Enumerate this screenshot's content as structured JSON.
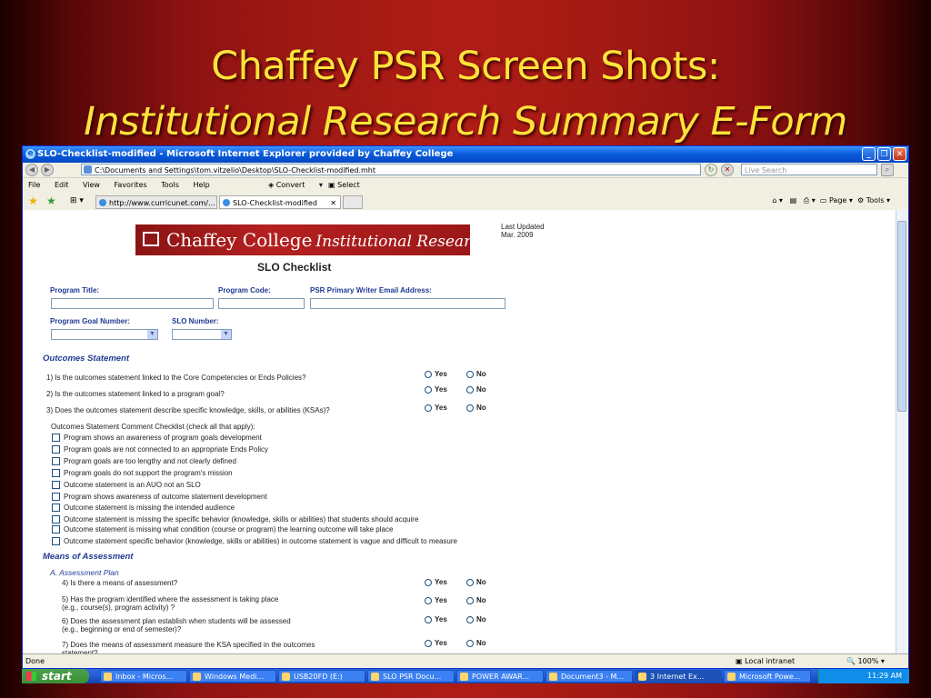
{
  "slide": {
    "title_line1": "Chaffey PSR Screen Shots:",
    "title_line2": "Institutional Research Summary E-Form"
  },
  "window": {
    "title": "SLO-Checklist-modified - Microsoft Internet Explorer provided by Chaffey College",
    "address": "C:\\Documents and Settings\\tom.vitzelio\\Desktop\\SLO-Checklist-modified.mht",
    "search_placeholder": "Live Search",
    "menu": [
      "File",
      "Edit",
      "View",
      "Favorites",
      "Tools",
      "Help"
    ],
    "toolbar": {
      "convert": "Convert",
      "select": "Select"
    },
    "tabs": [
      {
        "label": "http://www.curricunet.com/..."
      },
      {
        "label": "SLO-Checklist-modified"
      }
    ],
    "right_tools": {
      "page": "Page",
      "tools": "Tools"
    },
    "status": {
      "left": "Done",
      "zone": "Local intranet",
      "zoom": "100%"
    }
  },
  "page": {
    "banner": {
      "college": "Chaffey College",
      "tagline": "Institutional Research"
    },
    "updated_line1": "Last Updated",
    "updated_line2": "Mar. 2009",
    "heading": "SLO Checklist",
    "fields": {
      "program_title": "Program Title:",
      "program_code": "Program Code:",
      "psr_email": "PSR Primary Writer Email Address:",
      "goal_number": "Program Goal Number:",
      "slo_number": "SLO Number:"
    },
    "outcomes_heading": "Outcomes Statement",
    "yes": "Yes",
    "no": "No",
    "outcomes_questions": [
      "1) Is the outcomes statement linked to the Core Competencies or Ends Policies?",
      "2) Is the outcomes statement linked to a program goal?",
      "3) Does the outcomes statement describe specific knowledge, skills, or abilities (KSAs)?"
    ],
    "checklist_intro": "Outcomes Statement Comment Checklist (check all that apply):",
    "checklist": [
      "Program shows an awareness of program goals development",
      "Program goals are not connected to an appropriate Ends Policy",
      "Program goals are too lengthy and not clearly defined",
      "Program goals do not support the program's mission",
      "Outcome statement is an AUO not an SLO",
      "Program shows awareness of outcome statement development",
      "Outcome statement is missing the intended audience",
      "Outcome statement is missing the specific behavior (knowledge, skills or abilities) that students should acquire",
      "Outcome statement is missing what condition (course or program) the learning outcome will take place",
      "Outcome statement specific behavior (knowledge, skills or abilities) in outcome statement is vague and difficult to measure"
    ],
    "assessment_heading": "Means of Assessment",
    "assessment_plan": "A. Assessment Plan",
    "assessment_questions": [
      {
        "l1": "4) Is there a means of assessment?",
        "l2": ""
      },
      {
        "l1": "5) Has the program identified where the assessment is taking place",
        "l2": "(e.g., course(s), program activity) ?"
      },
      {
        "l1": "6) Does the assessment plan establish when students will be assessed",
        "l2": "(e.g., beginning or end of semester)?"
      },
      {
        "l1": "7) Does the means of assessment measure the KSA specified in the outcomes",
        "l2": "statement?"
      }
    ]
  },
  "taskbar": {
    "start": "start",
    "items": [
      "Inbox - Micros...",
      "Windows Medi...",
      "USB20FD (E:)",
      "SLO PSR Docu...",
      "POWER AWAR...",
      "Document3 - M...",
      "3 Internet Ex...",
      "Microsoft Powe..."
    ],
    "clock": "11:29 AM"
  }
}
